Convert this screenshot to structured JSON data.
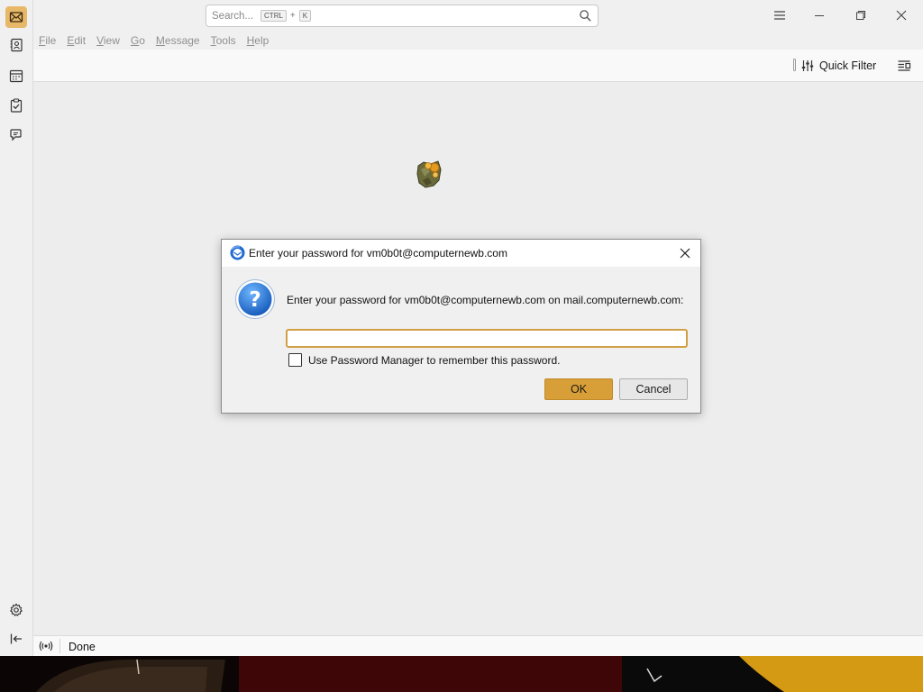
{
  "titlebar": {
    "search_placeholder": "Search...",
    "shortcut_key1": "CTRL",
    "shortcut_plus": "+",
    "shortcut_key2": "K"
  },
  "menubar": {
    "items": [
      {
        "label": "File",
        "mnemonic": "F",
        "rest": "ile"
      },
      {
        "label": "Edit",
        "mnemonic": "E",
        "rest": "dit"
      },
      {
        "label": "View",
        "mnemonic": "V",
        "rest": "iew"
      },
      {
        "label": "Go",
        "mnemonic": "G",
        "rest": "o"
      },
      {
        "label": "Message",
        "mnemonic": "M",
        "rest": "essage"
      },
      {
        "label": "Tools",
        "mnemonic": "T",
        "rest": "ools"
      },
      {
        "label": "Help",
        "mnemonic": "H",
        "rest": "elp"
      }
    ]
  },
  "filterbar": {
    "quick_filter_label": "Quick Filter"
  },
  "statusbar": {
    "status_text": "Done"
  },
  "dialog": {
    "title": "Enter your password for vm0b0t@computernewb.com",
    "message": "Enter your password for vm0b0t@computernewb.com on mail.computernewb.com:",
    "password_value": "",
    "remember_label": "Use Password Manager to remember this password.",
    "remember_checked": false,
    "ok_label": "OK",
    "cancel_label": "Cancel"
  },
  "icons": {
    "spaces": [
      "mail-icon",
      "address-book-icon",
      "calendar-icon",
      "tasks-icon",
      "chat-icon"
    ],
    "bottom": [
      "settings-icon",
      "collapse-sidebar-icon"
    ],
    "window": [
      "app-menu-icon",
      "minimize-icon",
      "restore-icon",
      "close-icon"
    ]
  },
  "colors": {
    "accent": "#d89e37",
    "active_space": "#e8b869",
    "input_focus_border": "#d2a044"
  }
}
